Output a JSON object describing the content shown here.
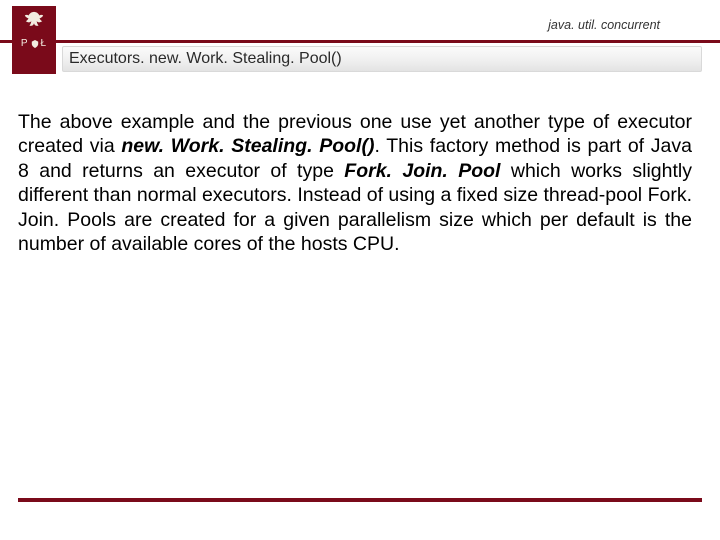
{
  "header": {
    "package": "java. util. concurrent",
    "logo_letters_left": "P",
    "logo_letters_right": "Ł",
    "title": "Executors. new. Work. Stealing. Pool()"
  },
  "body": {
    "t1": "The above example and the previous one use yet another type of executor created via ",
    "method": "new. Work. Stealing. Pool()",
    "t2": ". This factory method is part of Java 8 and returns an executor of type ",
    "klass": "Fork. Join. Pool",
    "t3": " which works slightly different than normal executors. Instead of using a fixed size thread-pool Fork. Join. Pools are created for a given parallelism size which per default is the number of available cores of the hosts CPU."
  },
  "colors": {
    "accent": "#7a0a1a"
  }
}
